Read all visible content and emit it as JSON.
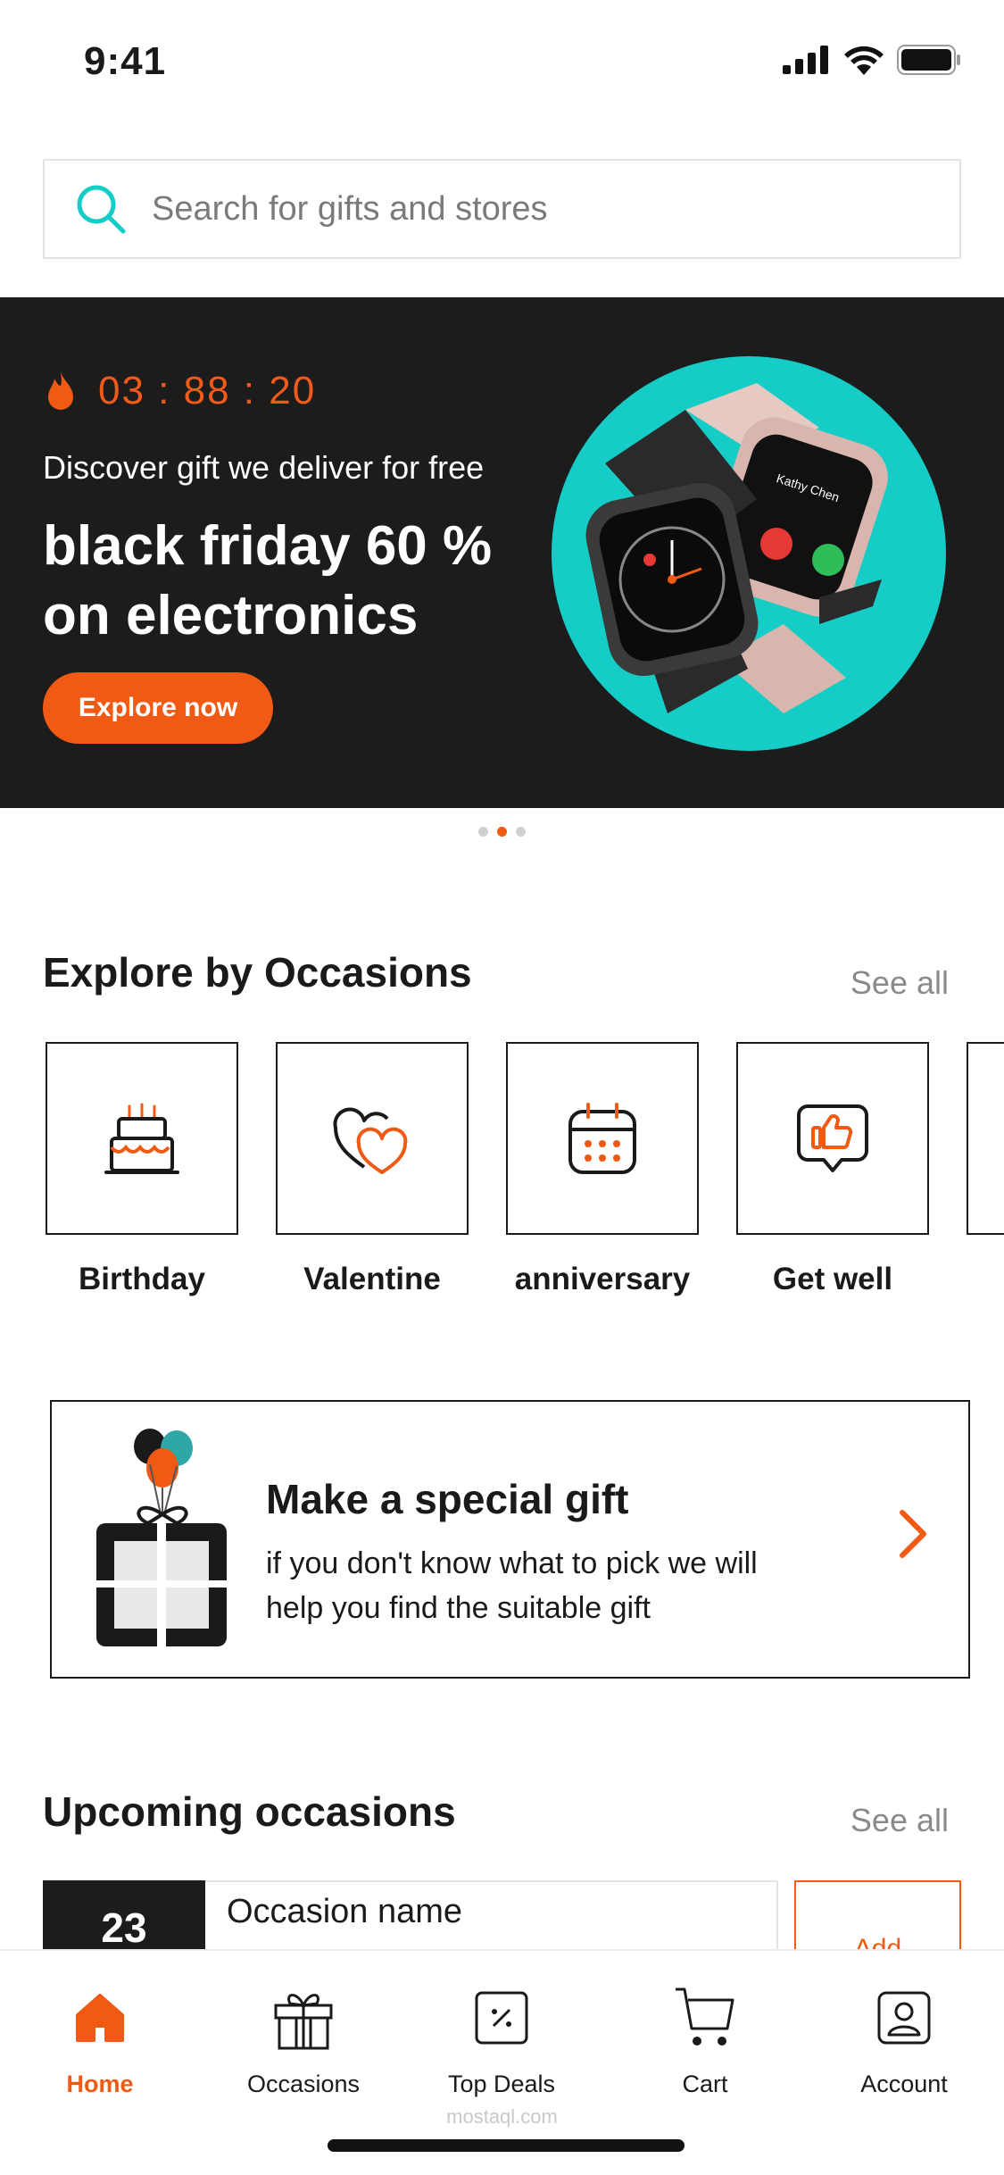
{
  "status_bar": {
    "time": "9:41"
  },
  "search": {
    "placeholder": "Search for gifts and stores"
  },
  "hero": {
    "timer": "03 : 88 : 20",
    "subtitle": "Discover gift we deliver for free",
    "title": "black friday 60 % on electronics",
    "button_label": "Explore now",
    "pagination": {
      "count": 3,
      "active_index": 1
    }
  },
  "occasions_section": {
    "title": "Explore by Occasions",
    "see_all": "See all",
    "items": [
      {
        "label": "Birthday",
        "icon": "birthday-cake-icon"
      },
      {
        "label": "Valentine",
        "icon": "hearts-icon"
      },
      {
        "label": "anniversary",
        "icon": "calendar-icon"
      },
      {
        "label": "Get well",
        "icon": "thumbs-up-icon"
      }
    ]
  },
  "special_gift": {
    "title": "Make a special gift",
    "description": "if you don't know what to pick we will help you find the suitable gift"
  },
  "upcoming_section": {
    "title": "Upcoming occasions",
    "see_all": "See all",
    "first_item": {
      "day": "23",
      "name": "Occasion name",
      "add_label": "Add"
    }
  },
  "bottom_nav": {
    "items": [
      {
        "label": "Home",
        "icon": "home-icon",
        "active": true
      },
      {
        "label": "Occasions",
        "icon": "gift-icon",
        "active": false
      },
      {
        "label": "Top Deals",
        "icon": "discount-icon",
        "active": false
      },
      {
        "label": "Cart",
        "icon": "cart-icon",
        "active": false
      },
      {
        "label": "Account",
        "icon": "account-icon",
        "active": false
      }
    ]
  },
  "watermark": "mostaql.com",
  "colors": {
    "accent": "#f05a14",
    "teal": "#16ccc6",
    "dark": "#1c1c1c"
  }
}
